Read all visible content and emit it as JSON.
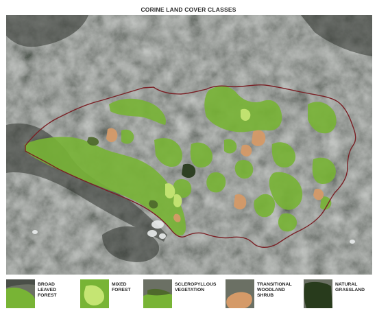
{
  "title": "CORINE LAND COVER CLASSES",
  "legend": [
    {
      "label": "BROAD\nLEAVED\nFOREST",
      "color": "#78b435",
      "icon": "broad-leaved-forest-swatch"
    },
    {
      "label": "MIXED\nFOREST",
      "color": "#c5e573",
      "icon": "mixed-forest-swatch"
    },
    {
      "label": "SCLEROPYLLOUS\nVEGETATION",
      "color": "#4f6a2c",
      "icon": "sclerophyllous-vegetation-swatch"
    },
    {
      "label": "TRANSITIONAL\nWOODLAND\nSHRUB",
      "color": "#d59a68",
      "icon": "transitional-woodland-shrub-swatch"
    },
    {
      "label": "NATURAL\nGRASSLAND",
      "color": "#283b1c",
      "icon": "natural-grassland-swatch"
    }
  ],
  "colors": {
    "boundary": "#7a1f24",
    "satellite_base": "#505550"
  }
}
